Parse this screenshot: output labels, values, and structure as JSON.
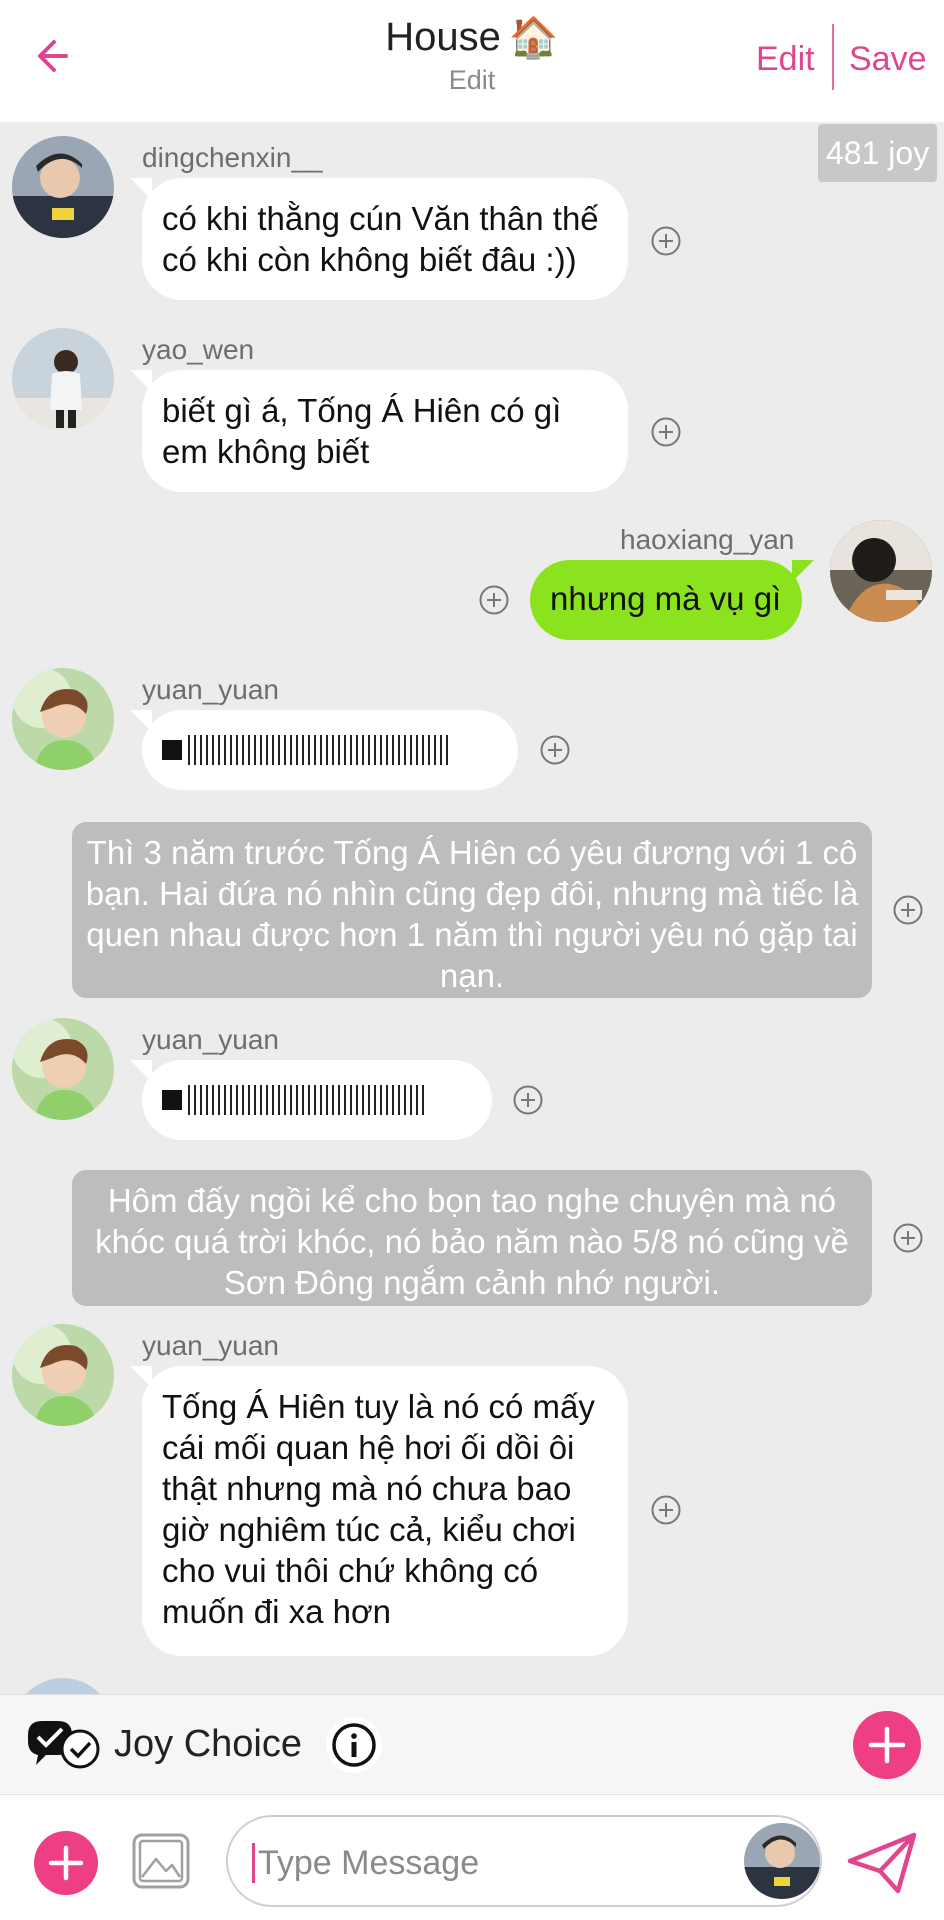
{
  "header": {
    "back_icon": "arrow-left-icon",
    "title": "House",
    "title_icon": "🏠",
    "subtitle": "Edit",
    "edit_label": "Edit",
    "save_label": "Save",
    "accent_color": "#e0468f"
  },
  "chat": {
    "joy_badge": "481 joy",
    "messages": [
      {
        "username": "dingchenxin__",
        "text": "có khi thằng cún Văn thân thế có khi còn không biết đâu :))"
      },
      {
        "username": "yao_wen",
        "text": "biết gì á, Tống Á Hiên có gì em không biết"
      },
      {
        "username": "haoxiang_yan",
        "text": "nhưng mà vụ gì"
      },
      {
        "username": "yuan_yuan",
        "type": "voice"
      },
      {
        "narration": "Thì 3 năm trước Tống Á Hiên có yêu đương với 1 cô bạn. Hai đứa nó nhìn cũng đẹp đôi, nhưng mà tiếc là quen nhau được hơn 1 năm thì người yêu nó gặp tai nạn."
      },
      {
        "username": "yuan_yuan",
        "type": "voice"
      },
      {
        "narration": "Hôm đấy ngồi kể cho bọn tao nghe chuyện mà nó khóc quá trời khóc, nó bảo năm nào 5/8 nó cũng về Sơn Đông ngắm cảnh nhớ người."
      },
      {
        "username": "yuan_yuan",
        "text": "Tống Á Hiên tuy là nó có mấy cái mối quan hệ hơi ối dồi ôi thật nhưng mà nó chưa bao giờ nghiêm túc cả, kiểu chơi cho vui thôi chứ không có muốn đi xa hơn"
      }
    ],
    "right_bubble_color": "#8be31d"
  },
  "joybar": {
    "label": "Joy Choice",
    "icon": "double-check-icon",
    "info_icon": "info-icon",
    "add_icon": "plus-icon"
  },
  "input": {
    "placeholder": "Type Message",
    "add_icon": "plus-icon",
    "image_icon": "image-icon",
    "send_icon": "send-icon"
  }
}
